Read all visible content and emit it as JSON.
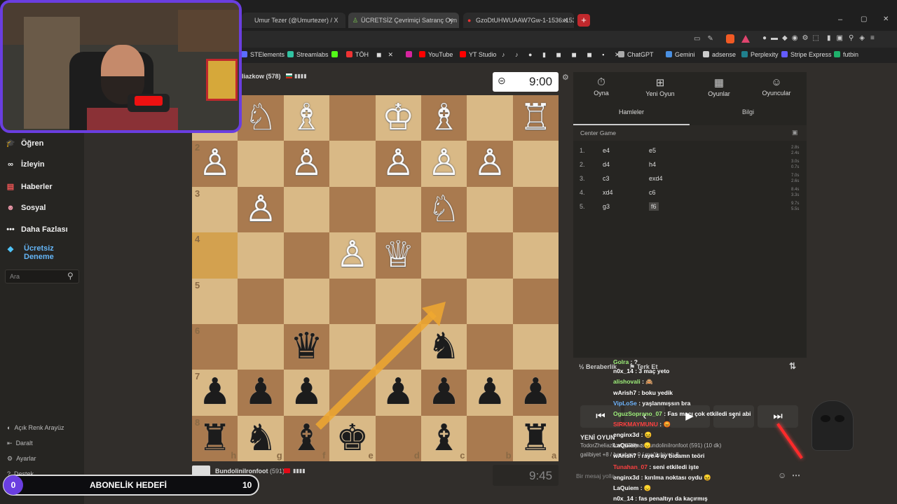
{
  "browser": {
    "tabs": [
      {
        "label": "Umur Tezer (@Umurtezer) / X",
        "active": false
      },
      {
        "label": "ÜCRETSİZ Çevrimiçi Satranç Oyn",
        "active": true
      },
      {
        "label": "GzoDtUHWUAAW7Gw-1-1536x1536",
        "active": false
      }
    ],
    "new_tab": "+",
    "bookmarks": [
      "STElements",
      "Streamlabs",
      "TÖH",
      "YouTube",
      "YT Studio",
      "ChatGPT",
      "Gemini",
      "adsense",
      "Perplexity",
      "Stripe Express",
      "futbin"
    ]
  },
  "sidebar": {
    "items": [
      {
        "label": "Öğren",
        "icon": "graduation-icon"
      },
      {
        "label": "İzleyin",
        "icon": "binoculars-icon"
      },
      {
        "label": "Haberler",
        "icon": "news-icon"
      },
      {
        "label": "Sosyal",
        "icon": "people-icon"
      },
      {
        "label": "Daha Fazlası",
        "icon": "more-icon"
      },
      {
        "label": "Ücretsiz Deneme",
        "icon": "diamond-icon"
      }
    ],
    "search_placeholder": "Ara",
    "bottom": [
      "Açık Renk Arayüz",
      "Daralt",
      "Ayarlar",
      "Destek"
    ]
  },
  "game": {
    "top_player": "liazkow (578)",
    "top_flag": "BG",
    "top_clock": "9:00",
    "bottom_player": "BundoliniIronfoot",
    "bottom_rating": "(591)",
    "bottom_clock": "9:45",
    "ranks": [
      "2",
      "3",
      "4",
      "5",
      "6",
      "7",
      "8"
    ],
    "files_bottom": [
      "h",
      "g",
      "f",
      "e",
      "d",
      "c",
      "b",
      "a"
    ]
  },
  "panel": {
    "tabs": [
      "Oyna",
      "Yeni Oyun",
      "Oyunlar",
      "Oyuncular"
    ],
    "subtabs": [
      "Hamleler",
      "Bilgi"
    ],
    "opening": "Center Game",
    "moves": [
      {
        "n": "1.",
        "w": "e4",
        "b": "e5",
        "t1": "2.8s",
        "t2": "2.4s"
      },
      {
        "n": "2.",
        "w": "d4",
        "b": "h4",
        "t1": "3.0s",
        "t2": "0.7s"
      },
      {
        "n": "3.",
        "w": "c3",
        "b": "exd4",
        "t1": "7.0s",
        "t2": "2.6s"
      },
      {
        "n": "4.",
        "w": "xd4",
        "b": "c6",
        "t1": "8.4s",
        "t2": "3.3s"
      },
      {
        "n": "5.",
        "w": "g3",
        "b": "f6",
        "t1": "9.7s",
        "t2": "5.5s"
      }
    ],
    "draw": "Beraberlik",
    "resign": "Terk Et"
  },
  "chat": {
    "placeholder": "Bir mesaj yolla",
    "new_game_title": "YENİ OYUN",
    "new_game_lines": [
      "TodorZheliazkow (578) vs BundoliniIronfoot (591) (10 dk)",
      "galibiyet +8 / berabere 0 / mağlubiyet -8"
    ],
    "messages": [
      {
        "user": "Golra",
        "text": " : ?",
        "color": "#9ef07a"
      },
      {
        "user": "n0x_14",
        "text": " : 3 maç yeto",
        "color": "#ffffff"
      },
      {
        "user": "alishovali",
        "text": " : 🙈",
        "color": "#9ef07a"
      },
      {
        "user": "wArish7",
        "text": " : boku yedik",
        "color": "#ffffff"
      },
      {
        "user": "VipLoSe",
        "text": " : yaşlanmışsın bra",
        "color": "#6fb6ff"
      },
      {
        "user": "OguzSoprano_07",
        "text": " : Fas maçı çok etkiledi seni abi",
        "color": "#9ef07a"
      },
      {
        "user": "SIRKMAYMUNU",
        "text": " : 😡",
        "color": "#ff4040"
      },
      {
        "user": "enginx3d",
        "text": " : 😖",
        "color": "#ffffff"
      },
      {
        "user": "LaQuiem",
        "text": " : 😞",
        "color": "#ffffff"
      },
      {
        "user": "wArish7",
        "text": " : raye 4 ay bidamn teöri",
        "color": "#ffffff"
      },
      {
        "user": "Tunahan_07",
        "text": " : seni etkiledi işte",
        "color": "#ff4040"
      },
      {
        "user": "enginx3d",
        "text": " : kırılma noktası oydu 😖",
        "color": "#ffffff"
      },
      {
        "user": "LaQuiem",
        "text": " : 😞",
        "color": "#ffffff"
      },
      {
        "user": "n0x_14",
        "text": " : fas penaltıyı da kaçırmış",
        "color": "#ffffff"
      }
    ]
  },
  "overlay": {
    "goal_left": "0",
    "goal_label": "ABONELİK HEDEFİ",
    "goal_right": "10"
  },
  "colors": {
    "light_square": "#d9b986",
    "dark_square": "#a97a4f",
    "accent_arrow": "#f0a830",
    "cam_border": "#6a3ee0"
  }
}
